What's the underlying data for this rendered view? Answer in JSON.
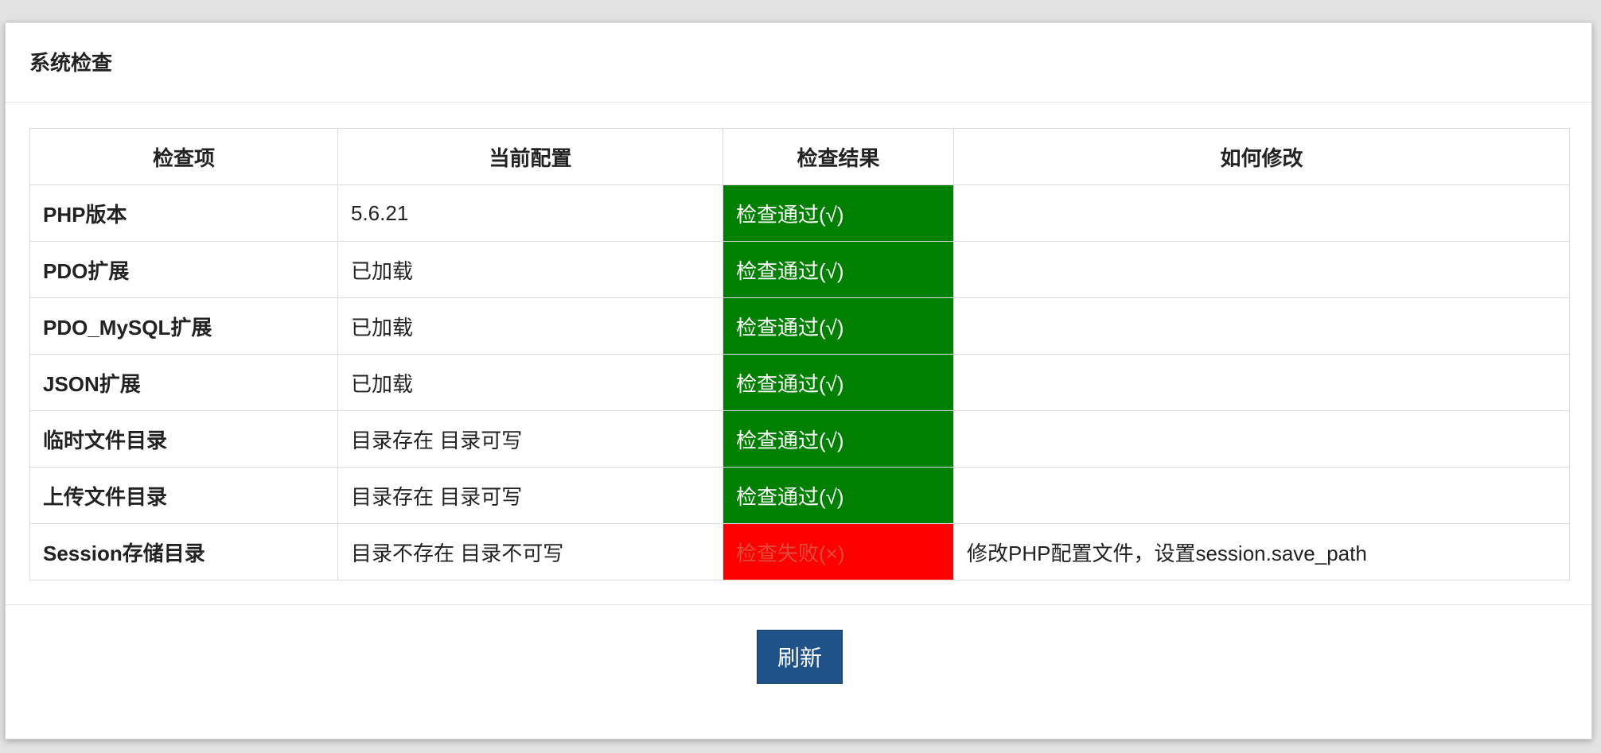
{
  "panel": {
    "title": "系统检查"
  },
  "table": {
    "headers": [
      "检查项",
      "当前配置",
      "检查结果",
      "如何修改"
    ],
    "rows": [
      {
        "item": "PHP版本",
        "config": "5.6.21",
        "result": "检查通过(√)",
        "status": "pass",
        "fix": ""
      },
      {
        "item": "PDO扩展",
        "config": "已加载",
        "result": "检查通过(√)",
        "status": "pass",
        "fix": ""
      },
      {
        "item": "PDO_MySQL扩展",
        "config": "已加载",
        "result": "检查通过(√)",
        "status": "pass",
        "fix": ""
      },
      {
        "item": "JSON扩展",
        "config": "已加载",
        "result": "检查通过(√)",
        "status": "pass",
        "fix": ""
      },
      {
        "item": "临时文件目录",
        "config": "目录存在 目录可写",
        "result": "检查通过(√)",
        "status": "pass",
        "fix": ""
      },
      {
        "item": "上传文件目录",
        "config": "目录存在 目录可写",
        "result": "检查通过(√)",
        "status": "pass",
        "fix": ""
      },
      {
        "item": "Session存储目录",
        "config": "目录不存在 目录不可写",
        "result": "检查失败(×)",
        "status": "fail",
        "fix": "修改PHP配置文件，设置session.save_path"
      }
    ]
  },
  "footer": {
    "refresh_label": "刷新"
  },
  "colors": {
    "pass": "#008000",
    "fail": "#ff0000",
    "button": "#1f5289"
  }
}
